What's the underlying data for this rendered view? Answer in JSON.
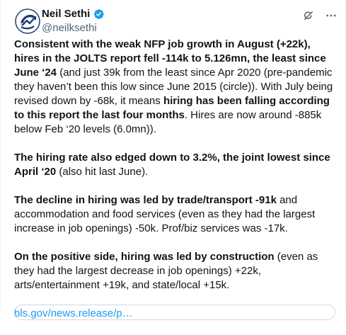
{
  "author": {
    "name": "Neil Sethi",
    "handle": "@neilksethi",
    "verified_color": "#1d9bf0"
  },
  "icons": {
    "avatar": "avatar-logo",
    "verified": "verified-badge-icon",
    "grok": "grok-icon",
    "more": "more-icon"
  },
  "paragraphs": {
    "p1": {
      "b1": "Consistent with the weak NFP job growth in August (+22k), hires in the JOLTS report fell -114k to 5.126mn, the least since June ‘24",
      "t1": " (and just 39k from the least since Apr 2020 (pre-pandemic they haven’t been this low since June 2015 (circle)). With July being revised down by -68k, it means ",
      "b2": "hiring has been falling according to this report the last four months",
      "t2": ". Hires are now around -885k below Feb ‘20 levels (6.0mn))."
    },
    "p2": {
      "b1": "The hiring rate also edged down to 3.2%, the joint lowest since April ‘20",
      "t1": " (also hit last June)."
    },
    "p3": {
      "b1": "The decline in hiring was led by trade/transport -91k",
      "t1": " and accommodation and food services (even as they had the largest increase in job openings) -50k. Prof/biz services was -17k."
    },
    "p4": {
      "b1": "On the positive side, hiring was led by construction",
      "t1": " (even as they had the largest decrease in job openings) +22k, arts/entertainment +19k, and state/local +15k."
    }
  },
  "link": {
    "text": "bls.gov/news.release/p…",
    "color": "#1d9bf0"
  }
}
